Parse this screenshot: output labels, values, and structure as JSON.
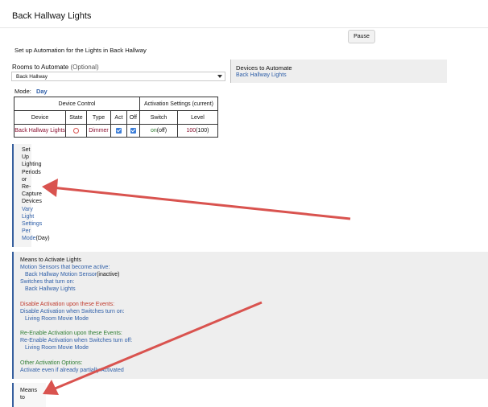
{
  "app": {
    "title": "Back Hallway Lights"
  },
  "toolbar": {
    "pause_label": "Pause"
  },
  "setup": {
    "heading": "Set up Automation for the Lights in Back Hallway"
  },
  "rooms": {
    "label": "Rooms to Automate",
    "optional": "(Optional)",
    "selected": "Back Hallway"
  },
  "devices": {
    "heading": "Devices to Automate",
    "value": "Back Hallway Lights"
  },
  "mode": {
    "label": "Mode:",
    "value": "Day"
  },
  "table": {
    "group_device_control": "Device Control",
    "group_activation": "Activation Settings (current)",
    "headers": [
      "Device",
      "State",
      "Type",
      "Act",
      "Off",
      "Switch",
      "Level"
    ],
    "row": {
      "device": "Back Hallway Lights",
      "type": "Dimmer",
      "switch_on": "on",
      "switch_cur": "(off)",
      "level_set": "100",
      "level_cur": "(100)"
    }
  },
  "lighting_periods": {
    "lines_dark": [
      "Set",
      "Up",
      "Lighting",
      "Periods",
      "or",
      "Re-",
      "Capture",
      "Devices"
    ],
    "lines_blue": [
      "Vary",
      "Light",
      "Settings",
      "Per",
      "Mode"
    ],
    "mode_suffix": "(Day)"
  },
  "means": {
    "title": "Means to Activate Lights",
    "motion_label": "Motion Sensors that become active:",
    "motion_sensor": "Back Hallway Motion Sensor",
    "motion_state": "(inactive)",
    "switches_label": "Switches that turn on:",
    "switches_value": "Back Hallway Lights",
    "disable_heading": "Disable Activation upon these Events:",
    "disable_label": "Disable Activation when Switches turn on:",
    "disable_value": "Living Room Movie Mode",
    "reenable_heading": "Re-Enable Activation upon these Events:",
    "reenable_label": "Re-Enable Activation when Switches turn off:",
    "reenable_value": "Living Room Movie Mode",
    "other_heading": "Other Activation Options:",
    "other_value": "Activate even if already partially Activated"
  },
  "bottom": {
    "line1": "Means",
    "line2": "to"
  },
  "colors": {
    "accent": "#2f5fa8",
    "arrow": "#d9534f",
    "panel": "#eeeeee"
  }
}
